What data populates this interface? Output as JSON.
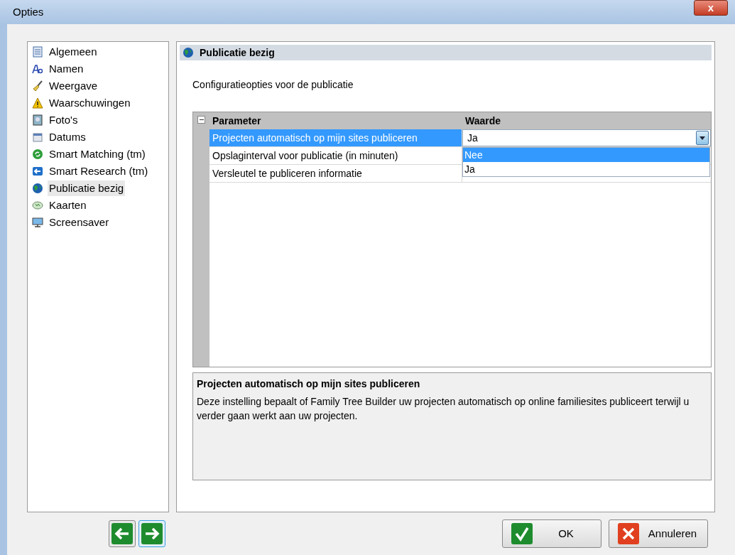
{
  "window": {
    "title": "Opties",
    "close": "x"
  },
  "sidebar": {
    "items": [
      {
        "label": "Algemeen",
        "kind": "document",
        "selected": false
      },
      {
        "label": "Namen",
        "kind": "font",
        "selected": false
      },
      {
        "label": "Weergave",
        "kind": "brush",
        "selected": false
      },
      {
        "label": "Waarschuwingen",
        "kind": "warning",
        "selected": false
      },
      {
        "label": "Foto's",
        "kind": "photo",
        "selected": false
      },
      {
        "label": "Datums",
        "kind": "calendar",
        "selected": false
      },
      {
        "label": "Smart Matching (tm)",
        "kind": "matching",
        "selected": false
      },
      {
        "label": "Smart Research (tm)",
        "kind": "research",
        "selected": false
      },
      {
        "label": "Publicatie bezig",
        "kind": "globe",
        "selected": true
      },
      {
        "label": "Kaarten",
        "kind": "map",
        "selected": false
      },
      {
        "label": "Screensaver",
        "kind": "monitor",
        "selected": false
      }
    ]
  },
  "panel": {
    "title": "Publicatie bezig",
    "subtitle": "Configuratieopties voor de publicatie"
  },
  "grid": {
    "columns": [
      "Parameter",
      "Waarde"
    ],
    "expanded": true,
    "rows": [
      {
        "parameter": "Projecten automatisch op mijn sites publiceren",
        "value": "Ja",
        "selected": true
      },
      {
        "parameter": "Opslaginterval voor publicatie (in minuten)",
        "selected": false
      },
      {
        "parameter": "Versleutel te publiceren informatie",
        "selected": false
      }
    ],
    "dropdown": {
      "options": [
        {
          "label": "Nee",
          "selected": true
        },
        {
          "label": "Ja",
          "selected": false
        }
      ]
    }
  },
  "description": {
    "title": "Projecten automatisch op mijn sites publiceren",
    "text": "Deze instelling bepaalt of Family Tree Builder uw projecten automatisch op online familiesites publiceert terwijl u verder gaan werkt aan uw projecten."
  },
  "buttons": [
    {
      "label": "OK",
      "kind": "ok"
    },
    {
      "label": "Annuleren",
      "kind": "cancel"
    }
  ]
}
